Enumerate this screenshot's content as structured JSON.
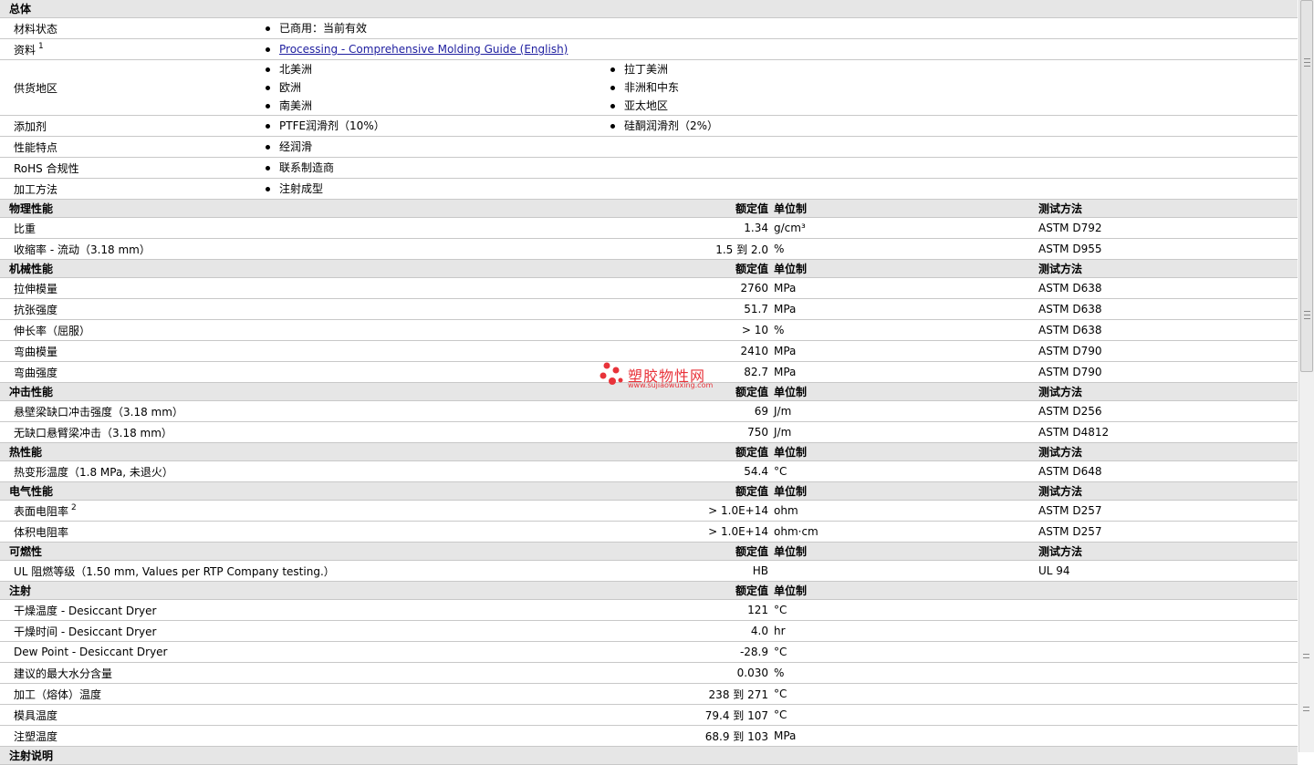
{
  "general": {
    "title": "总体",
    "rows": [
      {
        "label": "材料状态",
        "values": [
          "已商用：当前有效"
        ]
      },
      {
        "label": "资料",
        "sup": "1",
        "values": [
          "Processing - Comprehensive Molding Guide (English)"
        ],
        "link": true
      },
      {
        "label": "供货地区",
        "values": [
          "北美洲",
          "拉丁美洲",
          "欧洲",
          "非洲和中东",
          "南美洲",
          "亚太地区"
        ]
      },
      {
        "label": "添加剂",
        "values": [
          "PTFE润滑剂（10%）",
          "硅酮润滑剂（2%）"
        ]
      },
      {
        "label": "性能特点",
        "values": [
          "经润滑"
        ]
      },
      {
        "label": "RoHS 合规性",
        "values": [
          "联系制造商"
        ]
      },
      {
        "label": "加工方法",
        "values": [
          "注射成型"
        ]
      }
    ]
  },
  "headers": {
    "nominal": "额定值",
    "unit": "单位制",
    "test": "测试方法"
  },
  "sections": [
    {
      "title": "物理性能",
      "show_test": true,
      "rows": [
        {
          "label": "比重",
          "value": "1.34",
          "unit": "g/cm³",
          "test": "ASTM D792"
        },
        {
          "label": "收缩率  - 流动（3.18 mm）",
          "value": "1.5 到  2.0",
          "unit": "%",
          "test": "ASTM D955"
        }
      ]
    },
    {
      "title": "机械性能",
      "show_test": true,
      "rows": [
        {
          "label": "拉伸模量",
          "value": "2760",
          "unit": "MPa",
          "test": "ASTM D638"
        },
        {
          "label": "抗张强度",
          "value": "51.7",
          "unit": "MPa",
          "test": "ASTM D638"
        },
        {
          "label": "伸长率（屈服）",
          "value": "> 10",
          "unit": "%",
          "test": "ASTM D638"
        },
        {
          "label": "弯曲模量",
          "value": "2410",
          "unit": "MPa",
          "test": "ASTM D790"
        },
        {
          "label": "弯曲强度",
          "value": "82.7",
          "unit": "MPa",
          "test": "ASTM D790"
        }
      ]
    },
    {
      "title": "冲击性能",
      "show_test": true,
      "rows": [
        {
          "label": "悬壁梁缺口冲击强度（3.18 mm）",
          "value": "69",
          "unit": "J/m",
          "test": "ASTM D256"
        },
        {
          "label": "无缺口悬臂梁冲击（3.18 mm）",
          "value": "750",
          "unit": "J/m",
          "test": "ASTM D4812"
        }
      ]
    },
    {
      "title": "热性能",
      "show_test": true,
      "rows": [
        {
          "label": "热变形温度（1.8 MPa, 未退火）",
          "value": "54.4",
          "unit": "°C",
          "test": "ASTM D648"
        }
      ]
    },
    {
      "title": "电气性能",
      "show_test": true,
      "rows": [
        {
          "label": "表面电阻率",
          "sup": "2",
          "value": "> 1.0E+14",
          "unit": "ohm",
          "test": "ASTM D257"
        },
        {
          "label": "体积电阻率",
          "value": "> 1.0E+14",
          "unit": "ohm·cm",
          "test": "ASTM D257"
        }
      ]
    },
    {
      "title": "可燃性",
      "show_test": true,
      "rows": [
        {
          "label": "UL 阻燃等级（1.50 mm, Values per RTP Company testing.）",
          "value": "HB",
          "unit": "",
          "test": "UL 94"
        }
      ]
    },
    {
      "title": "注射",
      "show_test": false,
      "rows": [
        {
          "label": "干燥温度  - Desiccant Dryer",
          "value": "121",
          "unit": "°C",
          "test": ""
        },
        {
          "label": "干燥时间  - Desiccant Dryer",
          "value": "4.0",
          "unit": "hr",
          "test": ""
        },
        {
          "label": "Dew Point - Desiccant Dryer",
          "value": "-28.9",
          "unit": "°C",
          "test": ""
        },
        {
          "label": "建议的最大水分含量",
          "value": "0.030",
          "unit": "%",
          "test": ""
        },
        {
          "label": "加工（熔体）温度",
          "value": "238 到  271",
          "unit": "°C",
          "test": ""
        },
        {
          "label": "模具温度",
          "value": "79.4 到  107",
          "unit": "°C",
          "test": ""
        },
        {
          "label": "注塑温度",
          "value": "68.9 到  103",
          "unit": "MPa",
          "test": ""
        }
      ]
    },
    {
      "title": "注射说明",
      "show_test": false,
      "header_only": true,
      "rows": []
    }
  ],
  "watermark": {
    "text": "塑胶物性网",
    "url": "www.sujiaowuxing.com",
    "color": "#e8333a"
  }
}
